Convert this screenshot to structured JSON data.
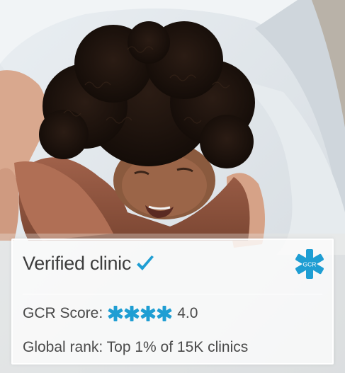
{
  "card": {
    "title": "Verified clinic",
    "logo_text": "GCR",
    "score_label": "GCR Score:",
    "score_value": "4.0",
    "rating_stars": 4,
    "rank_text": "Global rank: Top 1% of 15K clinics"
  },
  "icons": {
    "check": "check-icon",
    "logo": "gcr-logo-icon",
    "star": "asterisk-star-icon"
  },
  "colors": {
    "accent": "#1f9ed3",
    "text": "#3d3d3d"
  }
}
